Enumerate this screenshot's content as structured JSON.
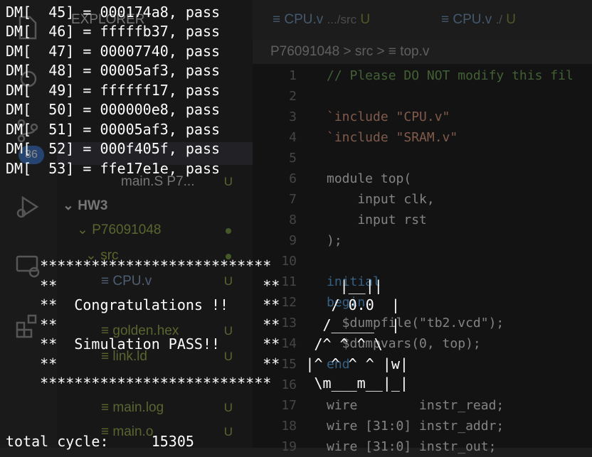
{
  "editor_bg": {
    "tabs": [
      {
        "name": "CPU.v",
        "path": ".../src",
        "status": "U"
      },
      {
        "name": "CPU.v",
        "path": "./",
        "status": "U"
      }
    ],
    "breadcrumb": "P76091048 > src > ≡ top.v",
    "explorer": {
      "section_header": "EXPLORER",
      "items": [
        {
          "label": "HW3",
          "status": ""
        },
        {
          "label": "P76091048",
          "status": "dot"
        },
        {
          "label": "src",
          "status": "dot"
        },
        {
          "label": "CPU.v",
          "status": "U"
        },
        {
          "label": "golden.hex",
          "status": "U"
        },
        {
          "label": "link.ld",
          "status": "U"
        },
        {
          "label": "main.log",
          "status": "U"
        },
        {
          "label": "main.o",
          "status": "U"
        },
        {
          "label": "main.S  P7...",
          "status": "U"
        }
      ],
      "badge": "36"
    },
    "code_lines": [
      {
        "num": "1",
        "text": "// Please DO NOT modify this fil"
      },
      {
        "num": "2",
        "text": ""
      },
      {
        "num": "3",
        "text": "`include \"CPU.v\""
      },
      {
        "num": "4",
        "text": "`include \"SRAM.v\""
      },
      {
        "num": "5",
        "text": ""
      },
      {
        "num": "6",
        "text": "module top("
      },
      {
        "num": "7",
        "text": "    input clk,"
      },
      {
        "num": "8",
        "text": "    input rst"
      },
      {
        "num": "9",
        "text": ");"
      },
      {
        "num": "10",
        "text": ""
      },
      {
        "num": "11",
        "text": "initial"
      },
      {
        "num": "12",
        "text": "begin"
      },
      {
        "num": "13",
        "text": "  $dumpfile(\"tb2.vcd\");"
      },
      {
        "num": "14",
        "text": "  $dumpvars(0, top);"
      },
      {
        "num": "15",
        "text": "end"
      },
      {
        "num": "16",
        "text": ""
      },
      {
        "num": "17",
        "text": "wire        instr_read;"
      },
      {
        "num": "18",
        "text": "wire [31:0] instr_addr;"
      },
      {
        "num": "19",
        "text": "wire [31:0] instr_out;"
      }
    ]
  },
  "terminal": {
    "lines": [
      "DM[  45] = 000174a8, pass",
      "DM[  46] = fffffb37, pass",
      "DM[  47] = 00007740, pass",
      "DM[  48] = 00005af3, pass",
      "DM[  49] = ffffff17, pass",
      "DM[  50] = 000000e8, pass",
      "DM[  51] = 00005af3, pass",
      "DM[  52] = 000f405f, pass",
      "DM[  53] = ffe17e1e, pass",
      "",
      "",
      "",
      "",
      "    ***************************",
      "    **                        **       |__||",
      "    **  Congratulations !!    **      / 0.0  |",
      "    **                        **     /_____  |",
      "    **  Simulation PASS!!     **    /^ ^ ^ \\",
      "    **                        **   |^ ^ ^ ^ |w|",
      "    ***************************     \\m___m__|_|",
      "",
      "",
      "total cycle:     15305"
    ]
  }
}
